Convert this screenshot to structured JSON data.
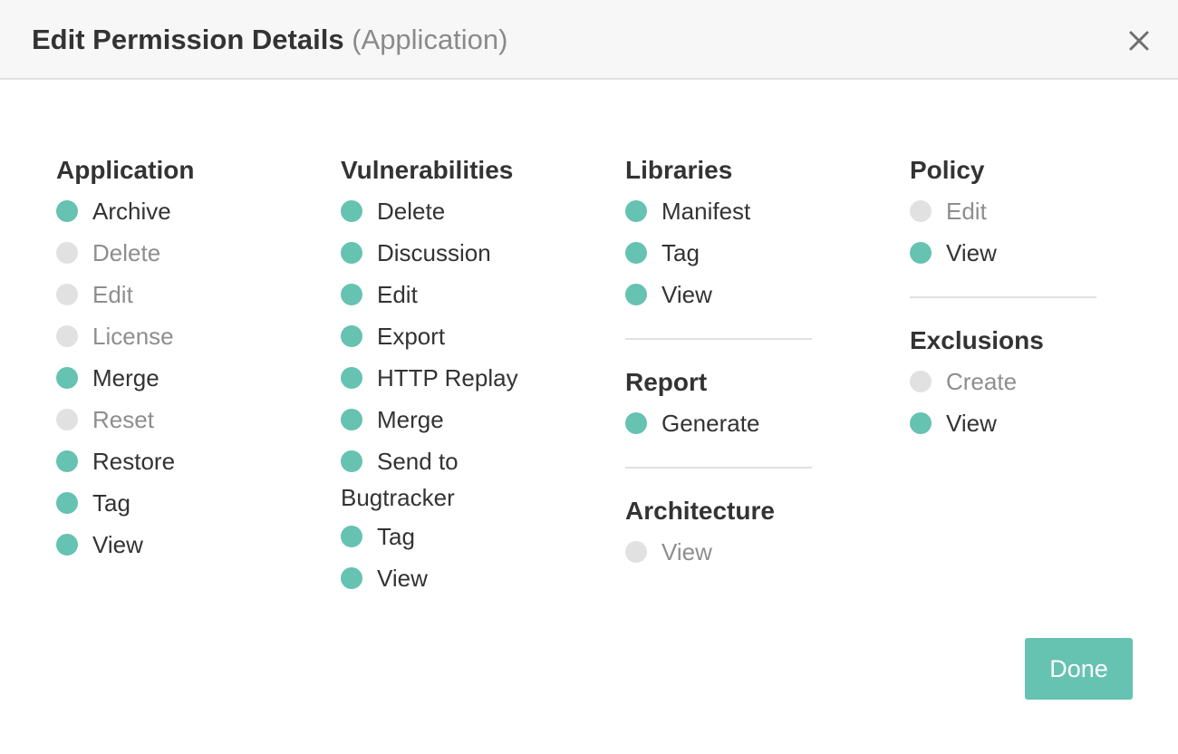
{
  "dialog": {
    "title": "Edit Permission Details",
    "subtitle": "(Application)",
    "close_icon": "close-icon",
    "done_label": "Done"
  },
  "colors": {
    "enabled": "#66c2b1",
    "disabled": "#e1e1e1",
    "button": "#66c2b1"
  },
  "columns": [
    {
      "groups": [
        {
          "title": "Application",
          "items": [
            {
              "label": "Archive",
              "enabled": true
            },
            {
              "label": "Delete",
              "enabled": false
            },
            {
              "label": "Edit",
              "enabled": false
            },
            {
              "label": "License",
              "enabled": false
            },
            {
              "label": "Merge",
              "enabled": true
            },
            {
              "label": "Reset",
              "enabled": false
            },
            {
              "label": "Restore",
              "enabled": true
            },
            {
              "label": "Tag",
              "enabled": true
            },
            {
              "label": "View",
              "enabled": true
            }
          ]
        }
      ]
    },
    {
      "groups": [
        {
          "title": "Vulnerabilities",
          "items": [
            {
              "label": "Delete",
              "enabled": true
            },
            {
              "label": "Discussion",
              "enabled": true
            },
            {
              "label": "Edit",
              "enabled": true
            },
            {
              "label": "Export",
              "enabled": true
            },
            {
              "label": "HTTP Replay",
              "enabled": true
            },
            {
              "label": "Merge",
              "enabled": true
            },
            {
              "label": "Send to Bugtracker",
              "enabled": true
            },
            {
              "label": "Tag",
              "enabled": true
            },
            {
              "label": "View",
              "enabled": true
            }
          ]
        }
      ]
    },
    {
      "groups": [
        {
          "title": "Libraries",
          "items": [
            {
              "label": "Manifest",
              "enabled": true
            },
            {
              "label": "Tag",
              "enabled": true
            },
            {
              "label": "View",
              "enabled": true
            }
          ]
        },
        {
          "title": "Report",
          "items": [
            {
              "label": "Generate",
              "enabled": true
            }
          ]
        },
        {
          "title": "Architecture",
          "items": [
            {
              "label": "View",
              "enabled": false
            }
          ]
        }
      ]
    },
    {
      "groups": [
        {
          "title": "Policy",
          "items": [
            {
              "label": "Edit",
              "enabled": false
            },
            {
              "label": "View",
              "enabled": true
            }
          ]
        },
        {
          "title": "Exclusions",
          "items": [
            {
              "label": "Create",
              "enabled": false
            },
            {
              "label": "View",
              "enabled": true
            }
          ]
        }
      ]
    }
  ]
}
